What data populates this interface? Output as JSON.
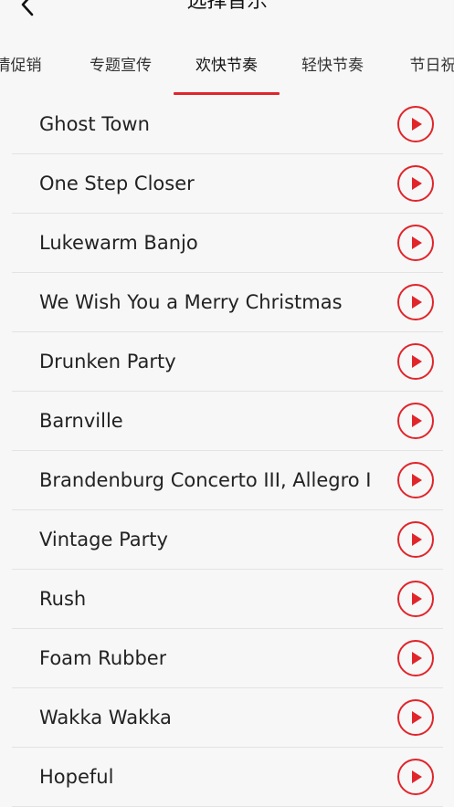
{
  "header": {
    "title": "选择音乐",
    "back_icon": "chevron-left-icon"
  },
  "accent_color": "#e0252b",
  "tabs": [
    {
      "label": "情促销",
      "active": false
    },
    {
      "label": "专题宣传",
      "active": false
    },
    {
      "label": "欢快节奏",
      "active": true
    },
    {
      "label": "轻快节奏",
      "active": false
    },
    {
      "label": "节日祝",
      "active": false
    }
  ],
  "tracks": [
    {
      "title": "Ghost Town"
    },
    {
      "title": "One Step Closer"
    },
    {
      "title": "Lukewarm Banjo"
    },
    {
      "title": "We Wish You a Merry Christmas"
    },
    {
      "title": "Drunken Party"
    },
    {
      "title": "Barnville"
    },
    {
      "title": "Brandenburg Concerto III, Allegro I"
    },
    {
      "title": "Vintage Party"
    },
    {
      "title": "Rush"
    },
    {
      "title": "Foam Rubber"
    },
    {
      "title": "Wakka Wakka"
    },
    {
      "title": "Hopeful"
    }
  ],
  "play_icon": "play-icon"
}
